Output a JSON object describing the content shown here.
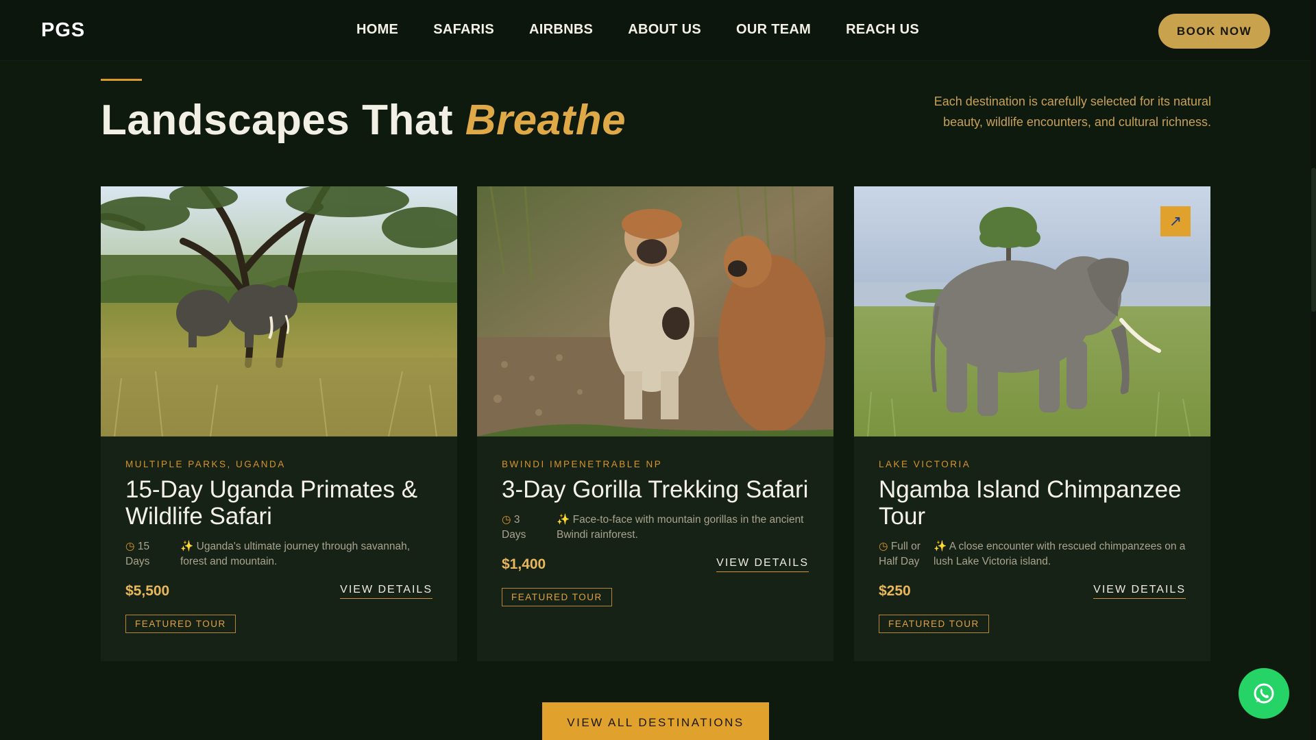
{
  "nav": {
    "logo": "PGS",
    "links": [
      "HOME",
      "SAFARIS",
      "AIRBNBS",
      "ABOUT US",
      "OUR TEAM",
      "REACH US"
    ],
    "book_label": "BOOK NOW"
  },
  "section": {
    "title_plain": "Landscapes That ",
    "title_accent": "Breathe",
    "intro": "Each destination is carefully selected for its natural beauty, wildlife encounters, and cultural richness."
  },
  "cards": [
    {
      "location": "MULTIPLE PARKS, UGANDA",
      "title": "15-Day Uganda Primates & Wildlife Safari",
      "duration_num": "15",
      "duration_unit": "Days",
      "description": "Uganda's ultimate journey through savannah, forest and mountain.",
      "price": "$5,500",
      "cta": "VIEW DETAILS",
      "badge": "FEATURED TOUR"
    },
    {
      "location": "BWINDI IMPENETRABLE NP",
      "title": "3-Day Gorilla Trekking Safari",
      "duration_num": "3",
      "duration_unit": "Days",
      "description": "Face-to-face with mountain gorillas in the ancient Bwindi rainforest.",
      "price": "$1,400",
      "cta": "VIEW DETAILS",
      "badge": "FEATURED TOUR"
    },
    {
      "location": "LAKE VICTORIA",
      "title": "Ngamba Island Chimpanzee Tour",
      "duration_num": "Full or",
      "duration_unit": "Half Day",
      "description": "A close encounter with rescued chimpanzees on a lush Lake Victoria island.",
      "price": "$250",
      "cta": "VIEW DETAILS",
      "badge": "FEATURED TOUR"
    }
  ],
  "icons": {
    "clock": "clock-icon",
    "sparkle": "sparkle-icon",
    "arrow": "arrow-up-right-icon",
    "whatsapp": "whatsapp-icon"
  },
  "view_all_label": "VIEW ALL DESTINATIONS",
  "colors": {
    "background": "#0f1a0f",
    "card": "#162216",
    "accent": "#d6952a",
    "button": "#c9a24e",
    "whatsapp": "#25d366"
  }
}
